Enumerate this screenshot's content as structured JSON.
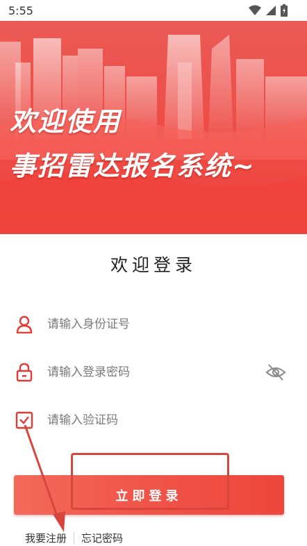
{
  "status": {
    "time": "5:55"
  },
  "banner": {
    "line1": "欢迎使用",
    "line2": "事招雷达报名系统~"
  },
  "login": {
    "title": "欢迎登录",
    "id_placeholder": "请输入身份证号",
    "password_placeholder": "请输入登录密码",
    "captcha_placeholder": "请输入验证码",
    "submit_label": "立即登录",
    "register_label": "我要注册",
    "forgot_label": "忘记密码"
  },
  "colors": {
    "accent": "#e53a33",
    "button": "#f05448"
  },
  "icons": [
    "wifi-icon",
    "signal-icon",
    "battery-icon",
    "user-icon",
    "lock-icon",
    "eye-off-icon",
    "checkbox-icon"
  ]
}
